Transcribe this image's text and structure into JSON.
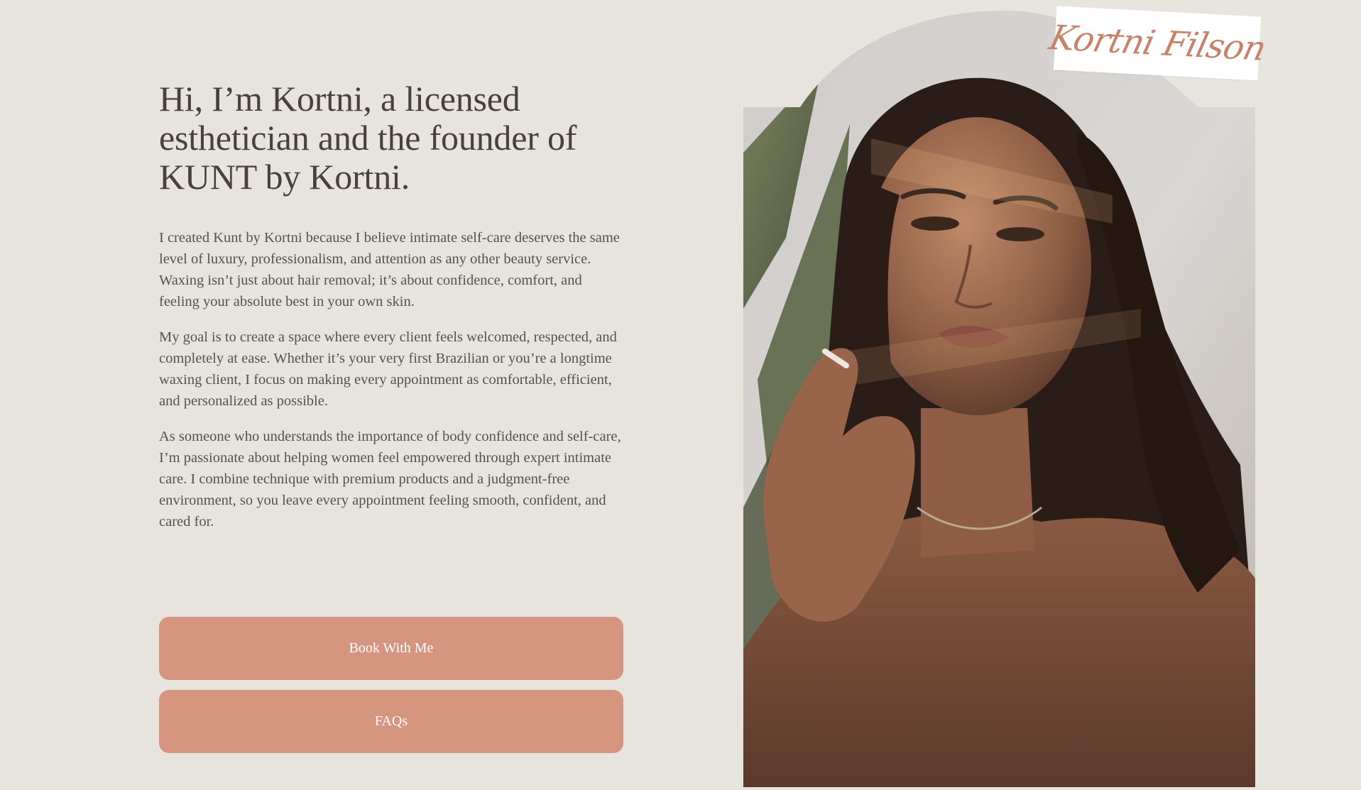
{
  "about": {
    "heading": "Hi, I’m Kortni, a licensed esthetician and the founder of KUNT by Kortni.",
    "paragraphs": [
      "I created Kunt by Kortni because I believe intimate self-care deserves the same level of luxury, professionalism, and attention as any other beauty service. Waxing isn’t just about hair removal; it’s about confidence, comfort, and feeling your absolute best in your own skin.",
      "My goal is to create a space where every client feels welcomed, respected, and completely at ease. Whether it’s your very first Brazilian or you’re a longtime waxing client, I focus on making every appointment as comfortable, efficient, and personalized as possible.",
      "As someone who understands the importance of body confidence and self-care, I’m passionate about helping women feel empowered through expert intimate care. I combine technique with premium products and a judgment-free environment, so you leave every appointment feeling smooth, confident, and cared for."
    ]
  },
  "buttons": {
    "book_label": "Book With Me",
    "faq_label": "FAQs"
  },
  "portrait": {
    "signature": "Kortni Filson"
  },
  "colors": {
    "background": "#e7e4de",
    "button": "#d5957f",
    "heading_text": "#4a3f3a",
    "body_text": "#5a4f4a",
    "signature": "#c9826a"
  }
}
